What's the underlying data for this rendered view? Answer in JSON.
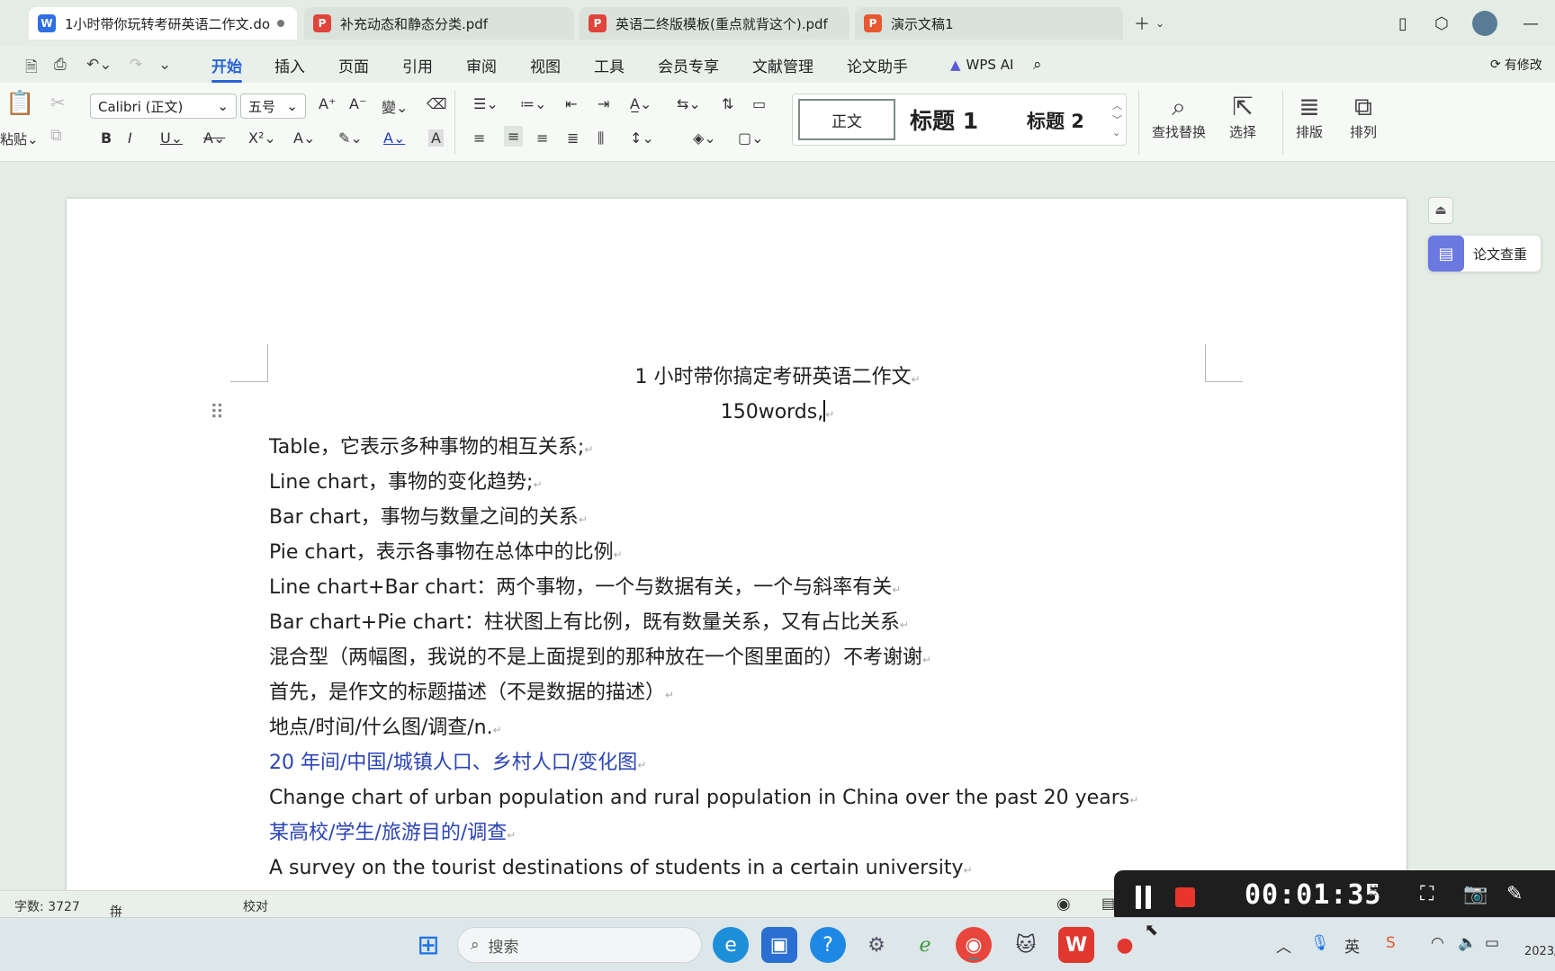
{
  "tabs": [
    {
      "label": "1小时带你玩转考研英语二作文.do",
      "type": "W",
      "active": true,
      "modified": true
    },
    {
      "label": "补充动态和静态分类.pdf",
      "type": "P",
      "active": false
    },
    {
      "label": "英语二终版模板(重点就背这个).pdf",
      "type": "P",
      "active": false
    },
    {
      "label": "演示文稿1",
      "type": "P",
      "active": false
    }
  ],
  "menu": {
    "items": [
      "开始",
      "插入",
      "页面",
      "引用",
      "审阅",
      "视图",
      "工具",
      "会员专享",
      "文献管理",
      "论文助手"
    ],
    "active": "开始",
    "wps_ai": "WPS AI",
    "right_label": "有修改"
  },
  "ribbon": {
    "paste": "粘贴",
    "font": "Calibri (正文)",
    "font_size": "五号",
    "styles": {
      "normal": "正文",
      "h1": "标题 1",
      "h2": "标题 2"
    },
    "find_replace": "查找替换",
    "select": "选择",
    "layout": "排版",
    "arrange": "排列"
  },
  "document": {
    "title": "1 小时带你搞定考研英语二作文",
    "subtitle": "150words,",
    "lines": [
      {
        "text": "Table，它表示多种事物的相互关系;",
        "blue": false
      },
      {
        "text": "Line chart，事物的变化趋势;",
        "blue": false
      },
      {
        "text": "Bar chart，事物与数量之间的关系",
        "blue": false
      },
      {
        "text": "Pie chart，表示各事物在总体中的比例",
        "blue": false
      },
      {
        "text": "Line chart+Bar chart：两个事物，一个与数据有关，一个与斜率有关",
        "blue": false
      },
      {
        "text": "Bar chart+Pie chart：柱状图上有比例，既有数量关系，又有占比关系",
        "blue": false
      },
      {
        "text": "混合型（两幅图，我说的不是上面提到的那种放在一个图里面的）不考谢谢",
        "blue": false
      },
      {
        "text": "首先，是作文的标题描述（不是数据的描述）",
        "blue": false
      },
      {
        "text": "地点/时间/什么图/调查/n.",
        "blue": false
      },
      {
        "text": "20 年间/中国/城镇人口、乡村人口/变化图",
        "blue": true
      },
      {
        "text": "Change chart of urban population and rural population in China over the past 20 years",
        "blue": false
      },
      {
        "text": "某高校/学生/旅游目的/调查",
        "blue": true
      },
      {
        "text": "A survey on the tourist destinations of students in a certain university",
        "blue": false
      }
    ]
  },
  "side_panel": {
    "paper_check": "论文查重"
  },
  "status": {
    "word_count": "字数: 3727",
    "spell_check": "拼写检查: 关闭",
    "proofread": "校对"
  },
  "recorder": {
    "time": "00:01:35"
  },
  "taskbar": {
    "search_placeholder": "搜索",
    "ime": "英",
    "date": "2023/"
  }
}
